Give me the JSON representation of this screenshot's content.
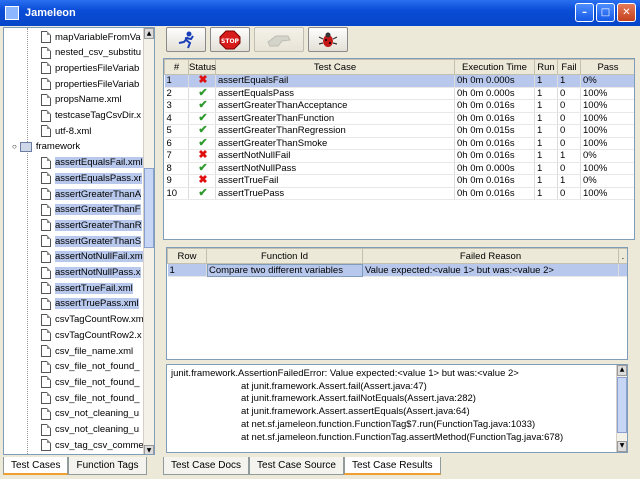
{
  "window": {
    "title": "Jameleon"
  },
  "tree": {
    "items": [
      {
        "label": "mapVariableFromVa",
        "type": "file",
        "indent": 2
      },
      {
        "label": "nested_csv_substitu",
        "type": "file",
        "indent": 2
      },
      {
        "label": "propertiesFileVariab",
        "type": "file",
        "indent": 2
      },
      {
        "label": "propertiesFileVariab",
        "type": "file",
        "indent": 2
      },
      {
        "label": "propsName.xml",
        "type": "file",
        "indent": 2
      },
      {
        "label": "testcaseTagCsvDir.x",
        "type": "file",
        "indent": 2
      },
      {
        "label": "utf-8.xml",
        "type": "file",
        "indent": 2
      },
      {
        "label": "framework",
        "type": "folder",
        "indent": 1
      },
      {
        "label": "assertEqualsFail.xml",
        "type": "file",
        "indent": 2,
        "selected": true
      },
      {
        "label": "assertEqualsPass.xr",
        "type": "file",
        "indent": 2,
        "selected": true
      },
      {
        "label": "assertGreaterThanA",
        "type": "file",
        "indent": 2,
        "selected": true
      },
      {
        "label": "assertGreaterThanF",
        "type": "file",
        "indent": 2,
        "selected": true
      },
      {
        "label": "assertGreaterThanR",
        "type": "file",
        "indent": 2,
        "selected": true
      },
      {
        "label": "assertGreaterThanS",
        "type": "file",
        "indent": 2,
        "selected": true
      },
      {
        "label": "assertNotNullFail.xm",
        "type": "file",
        "indent": 2,
        "selected": true
      },
      {
        "label": "assertNotNullPass.x",
        "type": "file",
        "indent": 2,
        "selected": true
      },
      {
        "label": "assertTrueFail.xml",
        "type": "file",
        "indent": 2,
        "selected": true
      },
      {
        "label": "assertTruePass.xml",
        "type": "file",
        "indent": 2,
        "selected": true
      },
      {
        "label": "csvTagCountRow.xm",
        "type": "file",
        "indent": 2
      },
      {
        "label": "csvTagCountRow2.x",
        "type": "file",
        "indent": 2
      },
      {
        "label": "csv_file_name.xml",
        "type": "file",
        "indent": 2
      },
      {
        "label": "csv_file_not_found_",
        "type": "file",
        "indent": 2
      },
      {
        "label": "csv_file_not_found_",
        "type": "file",
        "indent": 2
      },
      {
        "label": "csv_file_not_found_",
        "type": "file",
        "indent": 2
      },
      {
        "label": "csv_not_cleaning_u",
        "type": "file",
        "indent": 2
      },
      {
        "label": "csv_not_cleaning_u",
        "type": "file",
        "indent": 2
      },
      {
        "label": "csv_tag_csv_comme",
        "type": "file",
        "indent": 2
      }
    ]
  },
  "left_tabs": [
    "Test Cases",
    "Function Tags"
  ],
  "toolbar": {
    "run_icon": "run-icon",
    "stop_label": "STOP",
    "disabled_icon": "hand-icon",
    "debug_icon": "bug-icon"
  },
  "results": {
    "columns": [
      "#",
      "Status",
      "Test Case",
      "Execution Time",
      "Run",
      "Fail",
      "Pass"
    ],
    "rows": [
      {
        "n": "1",
        "status": "fail",
        "name": "assertEqualsFail",
        "time": "0h 0m 0.000s",
        "run": "1",
        "fail": "1",
        "pass": "0%",
        "selected": true
      },
      {
        "n": "2",
        "status": "pass",
        "name": "assertEqualsPass",
        "time": "0h 0m 0.000s",
        "run": "1",
        "fail": "0",
        "pass": "100%"
      },
      {
        "n": "3",
        "status": "pass",
        "name": "assertGreaterThanAcceptance",
        "time": "0h 0m 0.016s",
        "run": "1",
        "fail": "0",
        "pass": "100%"
      },
      {
        "n": "4",
        "status": "pass",
        "name": "assertGreaterThanFunction",
        "time": "0h 0m 0.016s",
        "run": "1",
        "fail": "0",
        "pass": "100%"
      },
      {
        "n": "5",
        "status": "pass",
        "name": "assertGreaterThanRegression",
        "time": "0h 0m 0.015s",
        "run": "1",
        "fail": "0",
        "pass": "100%"
      },
      {
        "n": "6",
        "status": "pass",
        "name": "assertGreaterThanSmoke",
        "time": "0h 0m 0.016s",
        "run": "1",
        "fail": "0",
        "pass": "100%"
      },
      {
        "n": "7",
        "status": "fail",
        "name": "assertNotNullFail",
        "time": "0h 0m 0.016s",
        "run": "1",
        "fail": "1",
        "pass": "0%"
      },
      {
        "n": "8",
        "status": "pass",
        "name": "assertNotNullPass",
        "time": "0h 0m 0.000s",
        "run": "1",
        "fail": "0",
        "pass": "100%"
      },
      {
        "n": "9",
        "status": "fail",
        "name": "assertTrueFail",
        "time": "0h 0m 0.016s",
        "run": "1",
        "fail": "1",
        "pass": "0%"
      },
      {
        "n": "10",
        "status": "pass",
        "name": "assertTruePass",
        "time": "0h 0m 0.016s",
        "run": "1",
        "fail": "0",
        "pass": "100%"
      }
    ]
  },
  "failures": {
    "columns": [
      "Row",
      "Function Id",
      "Failed Reason",
      "."
    ],
    "rows": [
      {
        "row": "1",
        "function": "Compare two different variables",
        "reason": "Value expected:<value 1> but was:<value 2>"
      }
    ]
  },
  "trace": {
    "lines": [
      "junit.framework.AssertionFailedError: Value expected:<value 1> but was:<value 2>",
      "at junit.framework.Assert.fail(Assert.java:47)",
      "at junit.framework.Assert.failNotEquals(Assert.java:282)",
      "at junit.framework.Assert.assertEquals(Assert.java:64)",
      "at net.sf.jameleon.function.FunctionTag$7.run(FunctionTag.java:1033)",
      "at net.sf.jameleon.function.FunctionTag.assertMethod(FunctionTag.java:678)"
    ]
  },
  "right_tabs": [
    "Test Case Docs",
    "Test Case Source",
    "Test Case Results"
  ],
  "colors": {
    "title_bar": "#0a4cd6",
    "selection": "#b8c8ec",
    "pass": "#2e9a2e",
    "fail": "#e01010"
  }
}
